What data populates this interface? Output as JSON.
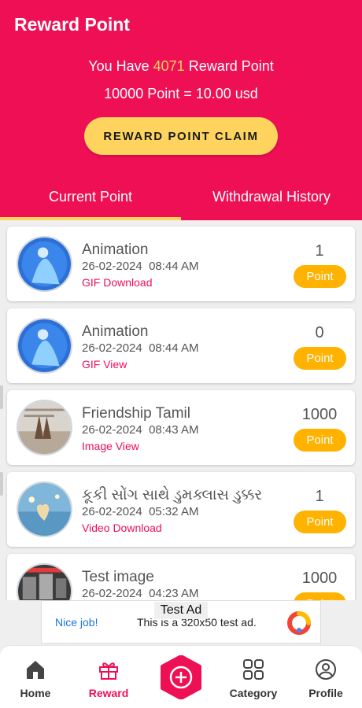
{
  "header": {
    "title": "Reward Point",
    "have_prefix": "You Have",
    "points": "4071",
    "have_suffix": "Reward Point",
    "rate": "10000 Point = 10.00 usd",
    "claim_label": "REWARD POINT CLAIM"
  },
  "tabs": {
    "current": "Current Point",
    "history": "Withdrawal History",
    "active": "current"
  },
  "items": [
    {
      "title": "Animation",
      "date": "26-02-2024  08:44 AM",
      "type": "GIF Download",
      "count": "1",
      "badge": "Point"
    },
    {
      "title": "Animation",
      "date": "26-02-2024  08:44 AM",
      "type": "GIF View",
      "count": "0",
      "badge": "Point"
    },
    {
      "title": "Friendship Tamil",
      "date": "26-02-2024  08:43 AM",
      "type": "Image View",
      "count": "1000",
      "badge": "Point"
    },
    {
      "title": "કૂકી સોંગ સાથે ડુમક્લાસ ડુક્કર",
      "date": "26-02-2024  05:32 AM",
      "type": "Video Download",
      "count": "1",
      "badge": "Point"
    },
    {
      "title": "Test image",
      "date": "26-02-2024  04:23 AM",
      "type": "",
      "count": "1000",
      "badge": "Point"
    }
  ],
  "ad": {
    "label": "Test Ad",
    "nice": "Nice job!",
    "text": "This is a 320x50 test ad."
  },
  "nav": {
    "home": "Home",
    "reward": "Reward",
    "category": "Category",
    "profile": "Profile",
    "active": "reward"
  },
  "colors": {
    "primary": "#ee0f55",
    "accent": "#ffd45e",
    "badge": "#ffb300"
  }
}
